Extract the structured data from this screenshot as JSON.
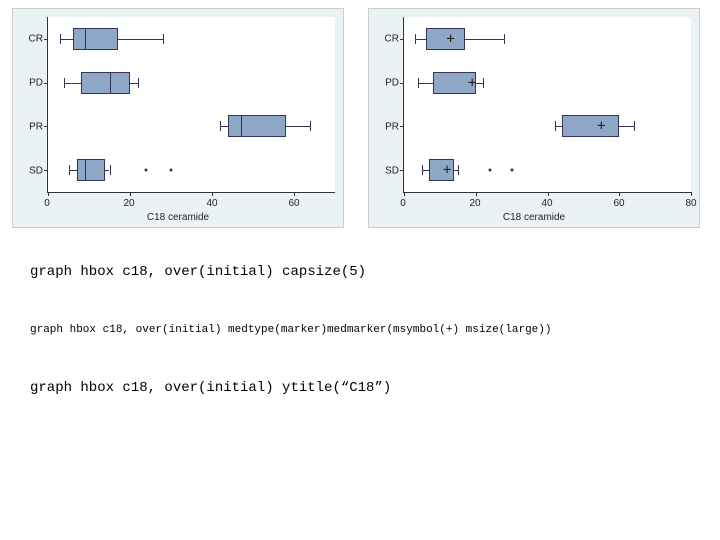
{
  "chart_data": [
    {
      "type": "box-horizontal",
      "title": "",
      "xlabel": "C18 ceramide",
      "xlim": [
        0,
        70
      ],
      "xticks": [
        0,
        20,
        40,
        60
      ],
      "categories": [
        "CR",
        "PD",
        "PR",
        "SD"
      ],
      "median_display": "line",
      "boxes": [
        {
          "cat": "CR",
          "low": 3,
          "q1": 6,
          "med": 9,
          "q3": 17,
          "high": 28,
          "outliers": []
        },
        {
          "cat": "PD",
          "low": 4,
          "q1": 8,
          "med": 15,
          "q3": 20,
          "high": 22,
          "outliers": []
        },
        {
          "cat": "PR",
          "low": 42,
          "q1": 44,
          "med": 47,
          "q3": 58,
          "high": 64,
          "outliers": []
        },
        {
          "cat": "SD",
          "low": 5,
          "q1": 7,
          "med": 9,
          "q3": 14,
          "high": 15,
          "outliers": [
            24,
            30
          ]
        }
      ]
    },
    {
      "type": "box-horizontal",
      "title": "",
      "xlabel": "C18 ceramide",
      "xlim": [
        0,
        80
      ],
      "xticks": [
        0,
        20,
        40,
        60,
        80
      ],
      "categories": [
        "CR",
        "PD",
        "PR",
        "SD"
      ],
      "median_display": "marker-plus",
      "boxes": [
        {
          "cat": "CR",
          "low": 3,
          "q1": 6,
          "med": 13,
          "q3": 17,
          "high": 28,
          "outliers": []
        },
        {
          "cat": "PD",
          "low": 4,
          "q1": 8,
          "med": 19,
          "q3": 20,
          "high": 22,
          "outliers": []
        },
        {
          "cat": "PR",
          "low": 42,
          "q1": 44,
          "med": 55,
          "q3": 60,
          "high": 64,
          "outliers": []
        },
        {
          "cat": "SD",
          "low": 5,
          "q1": 7,
          "med": 12,
          "q3": 14,
          "high": 15,
          "outliers": [
            24,
            30
          ]
        }
      ]
    }
  ],
  "left_chart": {
    "xtitle": "C18 ceramide",
    "yticks": [
      "CR",
      "PD",
      "PR",
      "SD"
    ],
    "xticks": [
      "0",
      "20",
      "40",
      "60"
    ]
  },
  "right_chart": {
    "xtitle": "C18 ceramide",
    "yticks": [
      "CR",
      "PD",
      "PR",
      "SD"
    ],
    "xticks": [
      "0",
      "20",
      "40",
      "60",
      "80"
    ]
  },
  "code": {
    "line1": "graph hbox c18, over(initial) capsize(5)",
    "line2": "graph hbox c18, over(initial) medtype(marker)medmarker(msymbol(+) msize(large))",
    "line3": "graph hbox c18, over(initial) ytitle(“C18”)"
  }
}
